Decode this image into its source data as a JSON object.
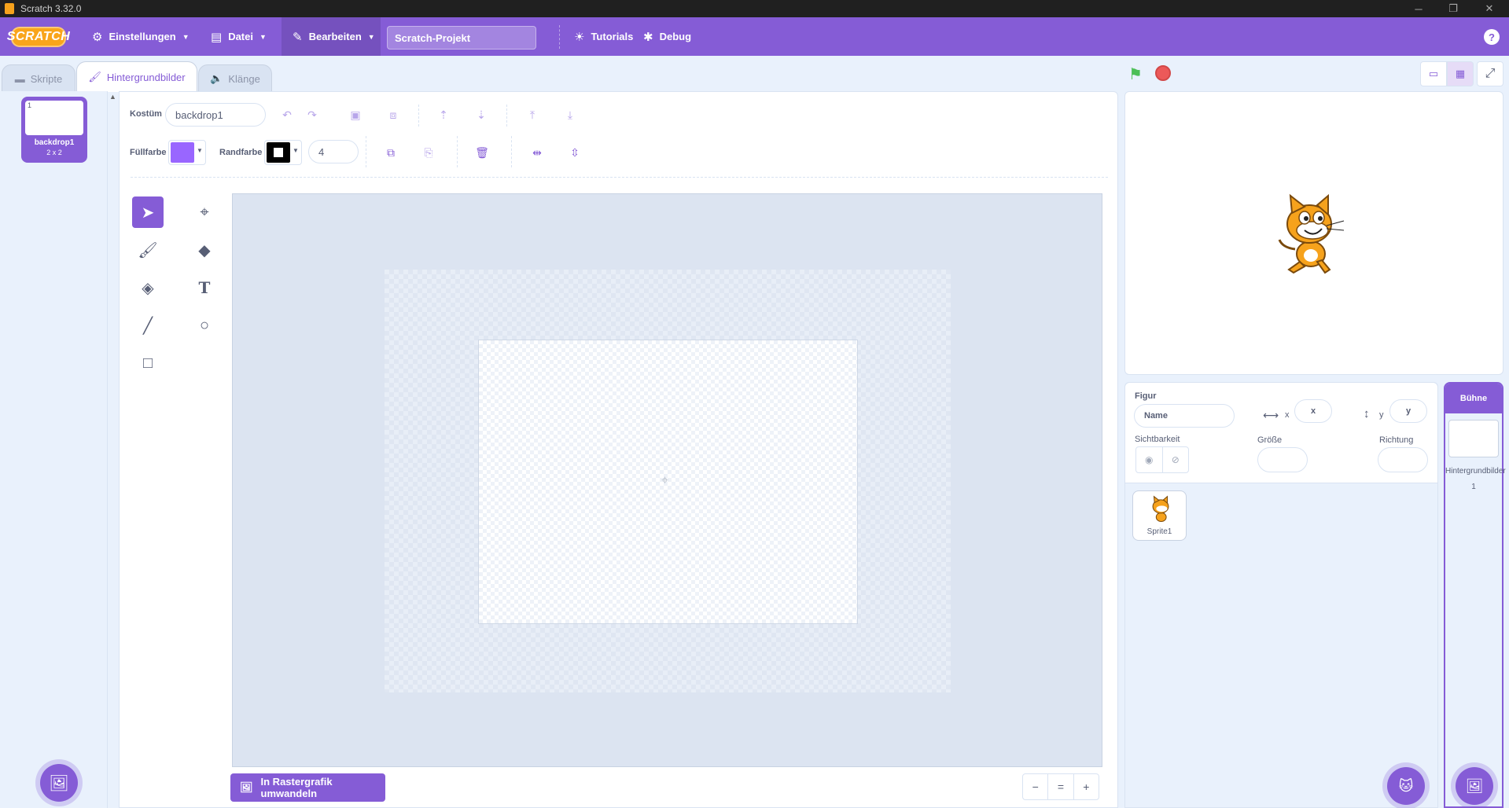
{
  "window": {
    "title": "Scratch 3.32.0",
    "minimize": "─",
    "maximize": "❐",
    "close": "✕"
  },
  "menubar": {
    "logo": "SCRATCH",
    "settings": "Einstellungen",
    "file": "Datei",
    "edit": "Bearbeiten",
    "project_title": "Scratch-Projekt",
    "tutorials": "Tutorials",
    "debug": "Debug",
    "help": "?"
  },
  "tabs": {
    "code": "Skripte",
    "backdrops": "Hintergrundbilder",
    "sounds": "Klänge"
  },
  "costumes": [
    {
      "number": "1",
      "name": "backdrop1",
      "size": "2 x 2"
    }
  ],
  "editor": {
    "costume_label": "Kostüm",
    "costume_name": "backdrop1",
    "fill_label": "Füllfarbe",
    "fill_color": "#9966ff",
    "outline_label": "Randfarbe",
    "outline_color": "#000000",
    "outline_width": "4",
    "convert_button": "In Rastergrafik umwandeln",
    "zoom_out": "−",
    "zoom_reset": "=",
    "zoom_in": "+"
  },
  "sprite_info": {
    "sprite_label": "Figur",
    "name_placeholder": "Name",
    "x_label": "x",
    "x_placeholder": "x",
    "y_label": "y",
    "y_placeholder": "y",
    "visibility_label": "Sichtbarkeit",
    "size_label": "Größe",
    "direction_label": "Richtung"
  },
  "sprites": [
    {
      "name": "Sprite1"
    }
  ],
  "stage_selector": {
    "title": "Bühne",
    "backdrops_label": "Hintergrundbilder",
    "backdrop_count": "1"
  },
  "colors": {
    "accent": "#855cd6",
    "green_flag": "#4cbf56",
    "stop": "#ec5959"
  }
}
